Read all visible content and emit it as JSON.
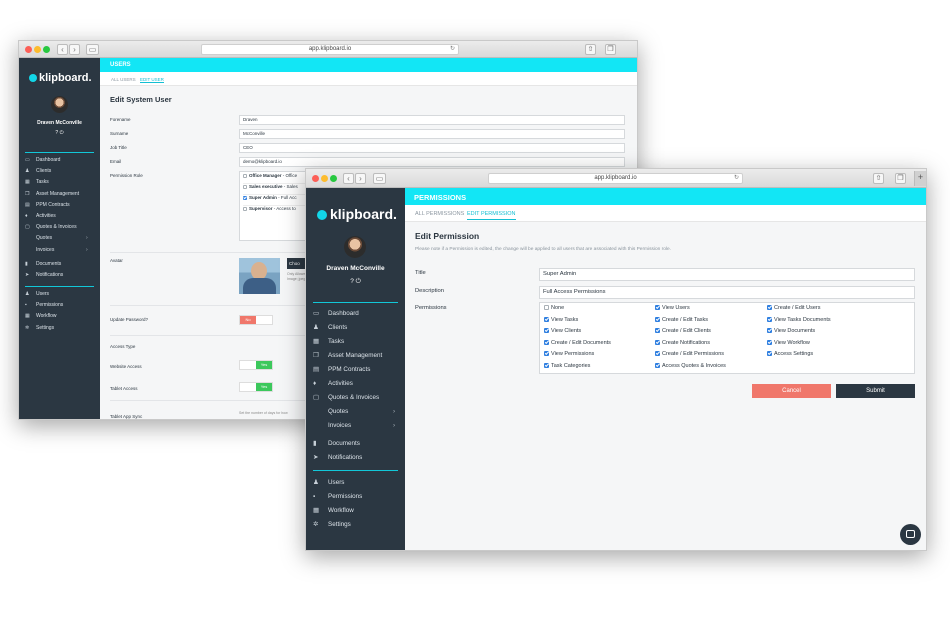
{
  "back": {
    "url": "app.klipboard.io",
    "brand": "klipboard.",
    "user_name": "Draven McConville",
    "user_icons": "? ⏻",
    "header": "USERS",
    "tabs": [
      "ALL USERS",
      "EDIT USER"
    ],
    "title": "Edit System User",
    "nav": [
      {
        "label": "Dashboard",
        "icon": "▭"
      },
      {
        "label": "Clients",
        "icon": "♟"
      },
      {
        "label": "Tasks",
        "icon": "▦"
      },
      {
        "label": "Asset Management",
        "icon": "❐"
      },
      {
        "label": "PPM Contracts",
        "icon": "▤"
      },
      {
        "label": "Activities",
        "icon": "♦"
      },
      {
        "label": "Quotes & Invoices",
        "icon": "▢"
      },
      {
        "label": "Quotes",
        "icon": "",
        "chev": "›"
      },
      {
        "label": "Invoices",
        "icon": "",
        "chev": "›"
      },
      {
        "label": "Documents",
        "icon": "▮"
      },
      {
        "label": "Notifications",
        "icon": "➤"
      },
      {
        "label": "Users",
        "icon": "♟"
      },
      {
        "label": "Permissions",
        "icon": "▪"
      },
      {
        "label": "Workflow",
        "icon": "▦"
      },
      {
        "label": "Settings",
        "icon": "✲"
      }
    ],
    "form": {
      "forename_label": "Forename",
      "forename": "Draven",
      "surname_label": "Surname",
      "surname": "McConville",
      "job_label": "Job Title",
      "job": "CEO",
      "email_label": "Email",
      "email": "demo@klipboard.io",
      "perm_label": "Permission Role",
      "roles": [
        {
          "name": "Office Manager",
          "desc": " - Office",
          "checked": false
        },
        {
          "name": "Sales executive",
          "desc": " - Sales",
          "checked": false
        },
        {
          "name": "Super Admin",
          "desc": " - Full Acc",
          "checked": true
        },
        {
          "name": "Supervisor",
          "desc": " - Access to",
          "checked": false
        }
      ],
      "avatar_label": "Avatar",
      "choose_label": "Choo",
      "avatar_hint1": "Only Allowe",
      "avatar_hint2": "Image; jpeg",
      "update_pw_label": "Update Password?",
      "update_pw_value": "No",
      "access_type_label": "Access Type",
      "website_label": "Website Access",
      "website_value": "Yes",
      "tablet_label": "Tablet Access",
      "tablet_value": "Yes",
      "tablet_sync_label": "Tablet App Sync",
      "tablet_sync_hint": "Set the number of days for how"
    }
  },
  "front": {
    "url": "app.klipboard.io",
    "brand": "klipboard.",
    "user_name": "Draven McConville",
    "user_icons": "? ⏻",
    "header": "PERMISSIONS",
    "tabs": [
      "ALL PERMISSIONS",
      "EDIT PERMISSION"
    ],
    "title": "Edit Permission",
    "note": "Please note if a Permission is edited, the change will be applied to all users that are associated with this Permission role.",
    "nav": [
      {
        "label": "Dashboard",
        "icon": "▭"
      },
      {
        "label": "Clients",
        "icon": "♟"
      },
      {
        "label": "Tasks",
        "icon": "▦"
      },
      {
        "label": "Asset Management",
        "icon": "❐"
      },
      {
        "label": "PPM Contracts",
        "icon": "▤"
      },
      {
        "label": "Activities",
        "icon": "♦"
      },
      {
        "label": "Quotes & Invoices",
        "icon": "▢"
      },
      {
        "label": "Quotes",
        "icon": "",
        "chev": "›"
      },
      {
        "label": "Invoices",
        "icon": "",
        "chev": "›"
      },
      {
        "label": "Documents",
        "icon": "▮"
      },
      {
        "label": "Notifications",
        "icon": "➤"
      },
      {
        "label": "Users",
        "icon": "♟"
      },
      {
        "label": "Permissions",
        "icon": "▪"
      },
      {
        "label": "Workflow",
        "icon": "▦"
      },
      {
        "label": "Settings",
        "icon": "✲"
      }
    ],
    "form": {
      "title_label": "Title",
      "title_value": "Super Admin",
      "desc_label": "Description",
      "desc_value": "Full Access Permissions",
      "perm_label": "Permissions",
      "permissions": [
        {
          "label": "None",
          "checked": false
        },
        {
          "label": "View Users",
          "checked": true
        },
        {
          "label": "Create / Edit Users",
          "checked": true
        },
        {
          "label": "View Tasks",
          "checked": true
        },
        {
          "label": "Create / Edit Tasks",
          "checked": true
        },
        {
          "label": "View Tasks Documents",
          "checked": true
        },
        {
          "label": "View Clients",
          "checked": true
        },
        {
          "label": "Create / Edit Clients",
          "checked": true
        },
        {
          "label": "View Documents",
          "checked": true
        },
        {
          "label": "Create / Edit Documents",
          "checked": true
        },
        {
          "label": "Create Notifications",
          "checked": true
        },
        {
          "label": "View Workflow",
          "checked": true
        },
        {
          "label": "View Permissions",
          "checked": true
        },
        {
          "label": "Create / Edit Permissions",
          "checked": true
        },
        {
          "label": "Access Settings",
          "checked": true
        },
        {
          "label": "Task Categories",
          "checked": true
        },
        {
          "label": "Access Quotes & Invoices",
          "checked": true
        }
      ],
      "cancel": "Cancel",
      "submit": "Submit"
    }
  },
  "colors": {
    "accent": "#12e6f5",
    "sidebar": "#2b3742",
    "cancel": "#f0776b",
    "submit": "#2b3742",
    "toggle_on": "#3cc85c",
    "toggle_no": "#f0776b"
  }
}
